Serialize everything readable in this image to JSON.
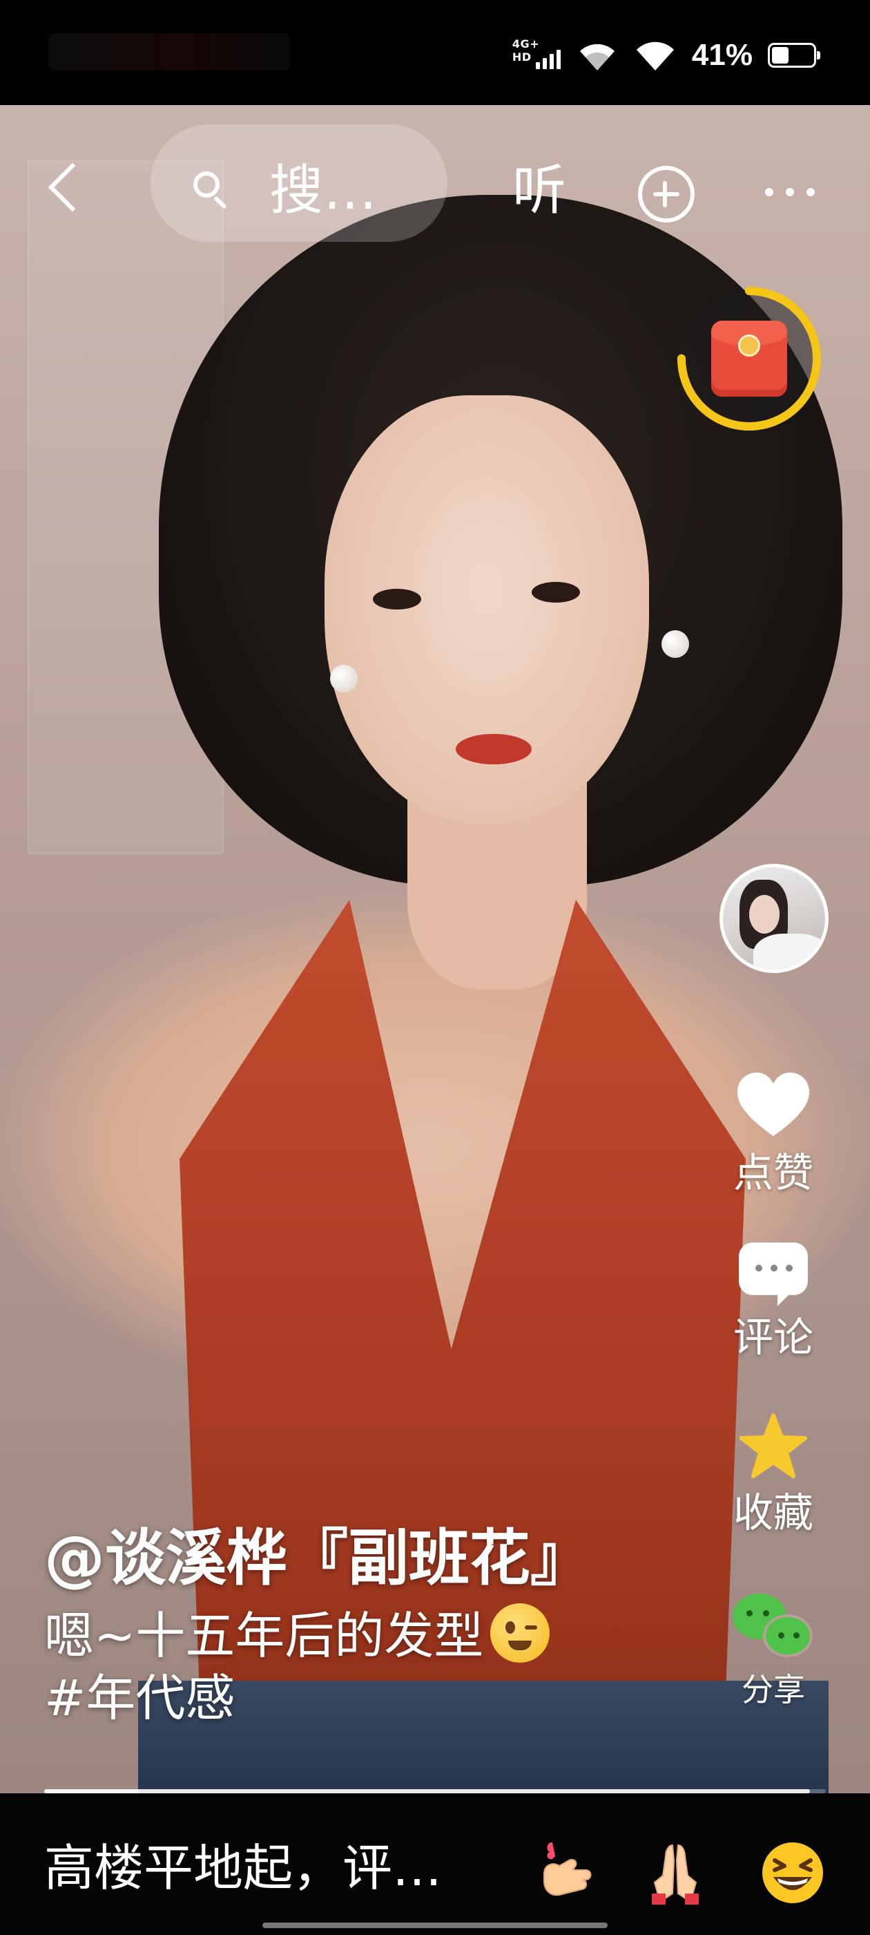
{
  "status_bar": {
    "network_label": "4G+ HD",
    "battery_text": "41%",
    "battery_level": 0.41
  },
  "top_nav": {
    "search_placeholder": "搜…",
    "listen_label": "听"
  },
  "side_actions": {
    "like_label": "点赞",
    "comment_label": "评论",
    "favorite_label": "收藏",
    "share_label": "分享"
  },
  "caption": {
    "author": "@谈溪桦『副班花』",
    "description": "嗯~十五年后的发型",
    "hashtag": "#年代感"
  },
  "playback": {
    "progress": 0.98
  },
  "bottom_bar": {
    "comment_placeholder": "高楼平地起，评…"
  },
  "colors": {
    "like_heart": "#ffffff",
    "favorite_star": "#f7c92e",
    "share_wechat": "#4fc24a",
    "red_packet": "#e74c3c",
    "red_packet_ring": "#f5c518"
  }
}
